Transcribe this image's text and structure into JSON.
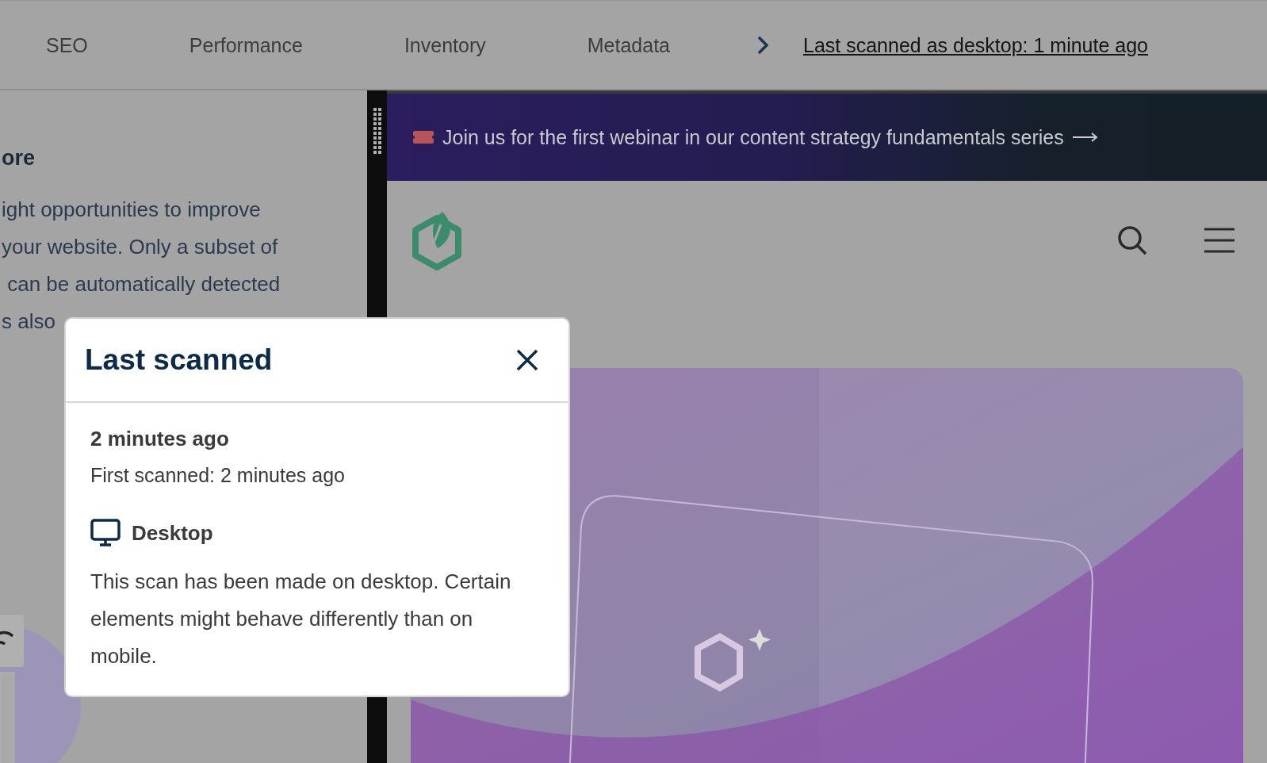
{
  "tabs": [
    {
      "label": "SEO"
    },
    {
      "label": "Performance"
    },
    {
      "label": "Inventory"
    },
    {
      "label": "Metadata"
    }
  ],
  "scan_link": "Last scanned as desktop: 1 minute ago",
  "left_panel": {
    "heading": "ore",
    "lines": [
      "ight opportunities to improve",
      "your website. Only a subset of",
      " can be automatically detected",
      "s also"
    ]
  },
  "preview": {
    "banner": "Join us for the first webinar in our content strategy fundamentals series"
  },
  "popup": {
    "title": "Last scanned",
    "time": "2 minutes ago",
    "first_scanned": "First scanned: 2 minutes ago",
    "device": {
      "kind": "desktop",
      "label": "Desktop"
    },
    "description": "This scan has been made on desktop. Certain elements might behave differently than on mobile."
  }
}
